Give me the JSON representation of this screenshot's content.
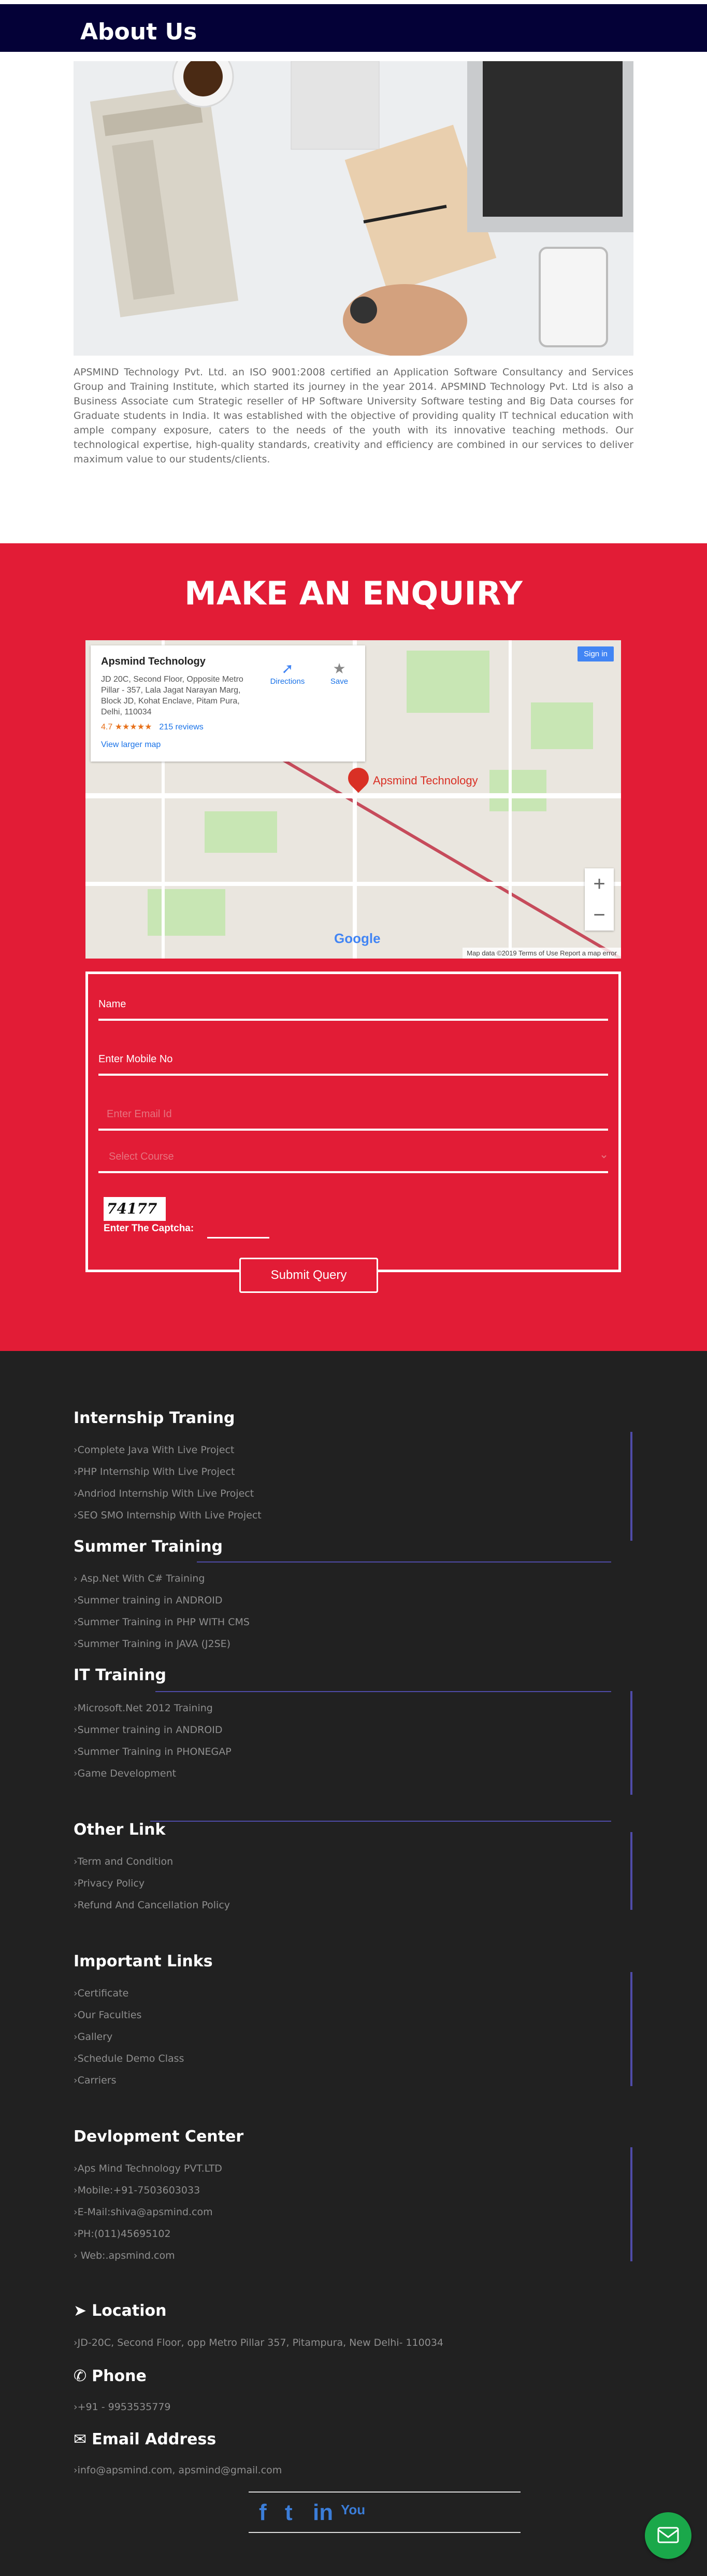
{
  "about": {
    "title": "About Us",
    "text": "APSMIND Technology Pvt. Ltd. an ISO 9001:2008 certified an Application Software Consultancy and Services Group and Training Institute, which started its journey in the year 2014. APSMIND Technology Pvt. Ltd is also a Business Associate cum Strategic reseller of HP Software University Software testing and Big Data courses for Graduate students in India. It was established with the objective of providing quality IT technical education with ample company exposure, caters to the needs of the youth with its innovative teaching methods. Our technological expertise, high-quality standards, creativity and efficiency are combined in our services to deliver maximum value to our students/clients."
  },
  "enquiry": {
    "title": "MAKE AN ENQUIRY",
    "map": {
      "place": "Apsmind Technology",
      "address": "JD 20C, Second Floor, Opposite Metro Pillar - 357, Lala Jagat Narayan Marg, Block JD, Kohat Enclave, Pitam Pura, Delhi, 110034",
      "rating": "4.7 ★★★★★",
      "reviews": "215 reviews",
      "larger_map": "View larger map",
      "directions": "Directions",
      "save": "Save",
      "sign_in": "Sign in",
      "pin_label": "Apsmind Technology",
      "google": "Google",
      "footer": "Map data ©2019   Terms of Use   Report a map error"
    },
    "form": {
      "name_placeholder": "Name",
      "mobile_placeholder": "Enter Mobile No",
      "email_placeholder": "Enter Email Id",
      "course_placeholder": "Select Course",
      "captcha_code": "74177",
      "captcha_label": "Enter The Captcha:",
      "submit": "Submit Query"
    }
  },
  "footer": {
    "internship": {
      "title": "Internship Traning",
      "items": [
        "›Complete Java With Live Project",
        "›PHP Internship With Live Project",
        "›Andriod Internship With Live Project",
        "›SEO SMO Internship With Live Project"
      ]
    },
    "summer": {
      "title": "Summer Training",
      "items": [
        "› Asp.Net With C# Training",
        "›Summer training in ANDROID",
        "›Summer Training in PHP WITH CMS",
        "›Summer Training in JAVA (J2SE)"
      ]
    },
    "it": {
      "title": "IT Training",
      "items": [
        "›Microsoft.Net 2012 Training",
        "›Summer training in ANDROID",
        "›Summer Training in PHONEGAP",
        "›Game Development"
      ]
    },
    "other": {
      "title": "Other Link",
      "items": [
        "›Term and Condition",
        "›Privacy Policy",
        "›Refund And Cancellation Policy"
      ]
    },
    "important": {
      "title": "Important Links",
      "items": [
        "›Certificate",
        "›Our Faculties",
        "›Gallery",
        "›Schedule Demo Class",
        "›Carriers"
      ]
    },
    "development": {
      "title": "Devlopment Center",
      "items": [
        "›Aps Mind Technology PVT.LTD",
        "›Mobile:+91-7503603033",
        "›E-Mail:shiva@apsmind.com",
        "›PH:(011)45695102",
        "› Web:.apsmind.com"
      ]
    },
    "location": {
      "title": "Location",
      "text": "›JD-20C, Second Floor, opp Metro Pillar 357, Pitampura, New Delhi- 110034"
    },
    "phone": {
      "title": "Phone",
      "text": "›+91 - 9953535779"
    },
    "email": {
      "title": "Email Address",
      "text": "›info@apsmind.com, apsmind@gmail.com"
    },
    "social": {
      "facebook": "f",
      "twitter": "t",
      "linkedin": "in",
      "youtube": "You"
    }
  },
  "colors": {
    "navy": "#040137",
    "red": "#e21c36",
    "footer": "#212121",
    "accent": "#4f4ba8"
  }
}
